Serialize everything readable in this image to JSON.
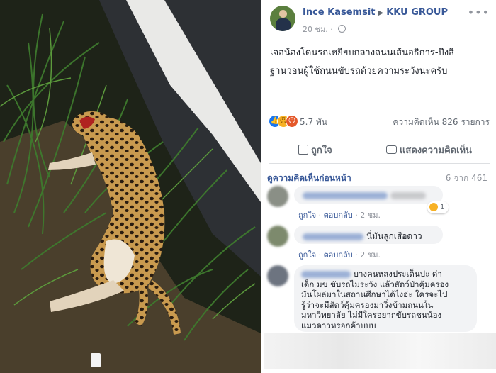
{
  "post": {
    "author": "Ince Kasemsit",
    "group": "KKU GROUP",
    "time": "20 ชม.",
    "text_line1": "เจอน้องโดนรถเหยียบกลางถนนเส้นอธิการ-บึงสี",
    "text_line2": "ฐานวอนผู้ใช้ถนนขับรถด้วยความระวังนะครับ",
    "reaction_count": "5.7 พัน",
    "comment_count": "ความคิดเห็น 826 รายการ",
    "like_label": "ถูกใจ",
    "comment_label": "แสดงความคิดเห็น",
    "more_label": "•••"
  },
  "comments_header": {
    "previous": "ดูความคิดเห็นก่อนหน้า",
    "paging": "6 จาก 461"
  },
  "comments": [
    {
      "text": "",
      "like": "ถูกใจ",
      "reply": "ตอบกลับ",
      "time": "2 ชม.",
      "reaction_count": "1"
    },
    {
      "text": "นี่มันลูกเสือดาว",
      "like": "ถูกใจ",
      "reply": "ตอบกลับ",
      "time": "2 ชม."
    },
    {
      "line1": "บางคนหลงประเด็นปะ ด่า",
      "line2": "เด็ก มข ขับรถไม่ระวัง แล้วสัตว์ป่าคุ้มครอง",
      "line3": "มันโผล่มาในสถานศึกษาได้ไงอ่ะ ใครจะไป",
      "line4": "รู้ว่าจะมีสัตว์คุ้มครองมาวิ่งข้ามถนนใน",
      "line5": "มหาวิทยาลัย ไม่มีใครอยากขับรถชนน้อง",
      "line6": "แมวดาวหรอกค้าบบบ"
    }
  ],
  "colors": {
    "link": "#385898",
    "muted": "#90949c",
    "bubble": "#f2f3f5",
    "like_blue": "#1877f2"
  }
}
